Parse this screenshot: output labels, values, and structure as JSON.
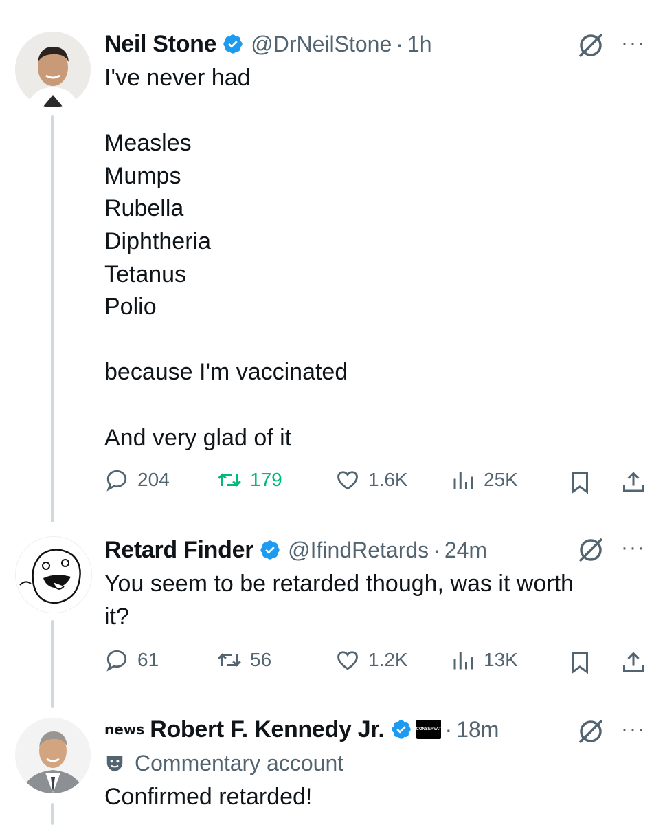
{
  "tweets": [
    {
      "name": "Neil Stone",
      "handle": "@DrNeilStone",
      "separator": "·",
      "time": "1h",
      "text": "I've never had\n\nMeasles\nMumps\nRubella\nDiphtheria\nTetanus\nPolio\n\nbecause I'm vaccinated\n\nAnd very glad of it",
      "replies": "204",
      "reposts": "179",
      "likes": "1.6K",
      "views": "25K"
    },
    {
      "name": "Retard Finder",
      "handle": "@IfindRetards",
      "separator": "·",
      "time": "24m",
      "text": "You seem to be retarded though, was it worth\nit?",
      "replies": "61",
      "reposts": "56",
      "likes": "1.2K",
      "views": "13K"
    },
    {
      "label_prefix": "news",
      "name": "Robert F. Kennedy Jr.",
      "affiliate_badge": "CONSERVATIVE",
      "separator": "·",
      "time": "18m",
      "account_label": "Commentary account",
      "text": "Confirmed retarded!"
    }
  ],
  "more_label": "···",
  "icons": [
    "verified-badge-icon",
    "grok-icon",
    "more-icon",
    "reply-icon",
    "repost-icon",
    "like-icon",
    "views-icon",
    "bookmark-icon",
    "share-icon",
    "theater-mask-icon"
  ],
  "colors": {
    "verified": "#1d9bf0",
    "repost_active": "#00ba7c",
    "secondary": "#536471",
    "thread_line": "#cfd9de"
  }
}
